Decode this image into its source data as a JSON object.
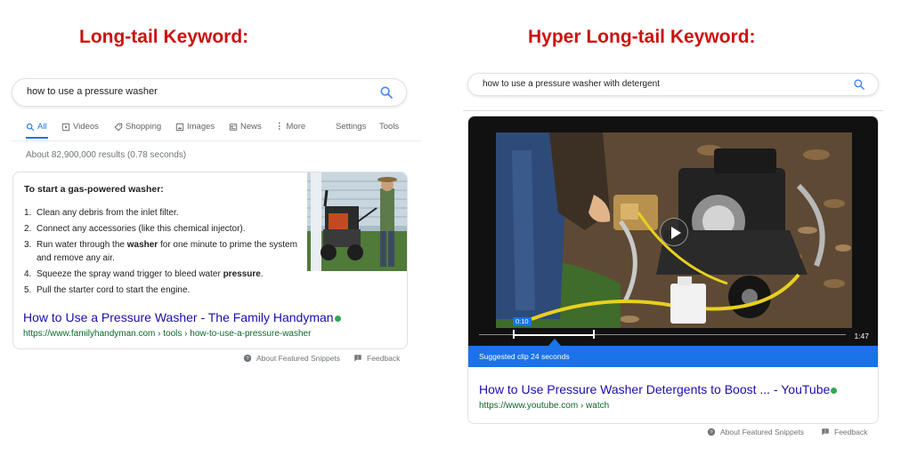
{
  "left": {
    "heading": "Long-tail Keyword:",
    "search": {
      "query": "how to use a pressure washer"
    },
    "tabs": [
      {
        "label": "All",
        "icon": "search-icon",
        "active": true
      },
      {
        "label": "Videos",
        "icon": "play-box-icon"
      },
      {
        "label": "Shopping",
        "icon": "tag-icon"
      },
      {
        "label": "Images",
        "icon": "image-icon"
      },
      {
        "label": "News",
        "icon": "newspaper-icon"
      },
      {
        "label": "More",
        "icon": "more-vert-icon"
      },
      {
        "label": "Settings"
      },
      {
        "label": "Tools"
      }
    ],
    "result_stats": "About 82,900,000 results (0.78 seconds)",
    "snippet": {
      "title_prefix": "To start a gas-powered ",
      "title_bold": "washer",
      "title_suffix": ":",
      "steps": [
        {
          "num": "1.",
          "parts": [
            "Clean any debris from the inlet filter."
          ]
        },
        {
          "num": "2.",
          "parts": [
            "Connect any accessories (like this chemical injector)."
          ]
        },
        {
          "num": "3.",
          "parts": [
            "Run water through the ",
            "washer",
            " for one minute to prime the system and remove any air."
          ]
        },
        {
          "num": "4.",
          "parts": [
            "Squeeze the spray wand trigger to bleed water ",
            "pressure",
            "."
          ]
        },
        {
          "num": "5.",
          "parts": [
            "Pull the starter cord to start the engine."
          ]
        }
      ],
      "link_title": "How to Use a Pressure Washer - The Family Handyman",
      "link_url": "https://www.familyhandyman.com › tools › how-to-use-a-pressure-washer"
    },
    "footer": {
      "about": "About Featured Snippets",
      "feedback": "Feedback"
    }
  },
  "right": {
    "heading": "Hyper Long-tail Keyword:",
    "search": {
      "query": "how to use a pressure washer with detergent"
    },
    "video": {
      "current_time": "0:10",
      "duration": "1:47",
      "suggested": "Suggested clip 24 seconds"
    },
    "link_title": "How to Use Pressure Washer Detergents to Boost ... - YouTube",
    "link_url": "https://www.youtube.com › watch",
    "footer": {
      "about": "About Featured Snippets",
      "feedback": "Feedback"
    }
  },
  "colors": {
    "heading": "#cc1111",
    "link": "#1a0dab",
    "url": "#0d652d",
    "accent": "#1a73e8",
    "verified_dot": "#34a853"
  }
}
